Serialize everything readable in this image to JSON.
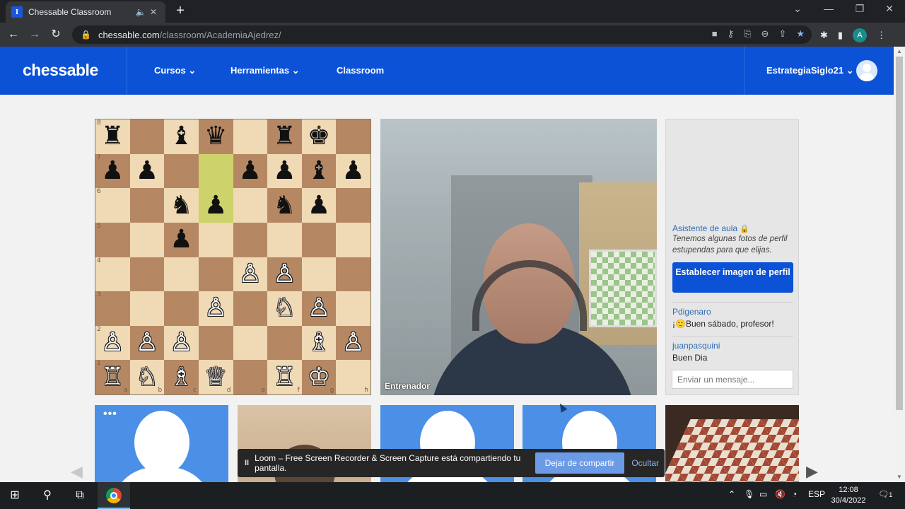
{
  "browser": {
    "tab_title": "Chessable Classroom",
    "favicon_letter": "I",
    "new_tab": "+",
    "url_host": "chessable.com",
    "url_path": "/classroom/AcademiaAjedrez/",
    "profile_letter": "A",
    "icons": [
      "back-icon",
      "forward-icon",
      "reload-icon",
      "lock-icon",
      "camera-icon",
      "key-icon",
      "translate-icon",
      "zoom-icon",
      "share-icon",
      "star-icon",
      "extensions-icon",
      "sidepanel-icon",
      "menu-icon"
    ]
  },
  "nav": {
    "logo": "chessable",
    "items": [
      {
        "label": "Cursos"
      },
      {
        "label": "Herramientas"
      },
      {
        "label": "Classroom"
      }
    ],
    "username": "EstrategiaSiglo21"
  },
  "board": {
    "ranks": [
      "8",
      "7",
      "6",
      "5",
      "4",
      "3",
      "2",
      "1"
    ],
    "files": [
      "a",
      "b",
      "c",
      "d",
      "e",
      "f",
      "g",
      "h"
    ],
    "highlight": [
      "d7",
      "d6"
    ],
    "pieces": {
      "a8": "♜",
      "c8": "♝",
      "d8": "♛",
      "f8": "♜",
      "g8": "♚",
      "a7": "♟",
      "b7": "♟",
      "e7": "♟",
      "f7": "♟",
      "g7": "♝",
      "h7": "♟",
      "c6": "♞",
      "d6": "♟",
      "f6": "♞",
      "g6": "♟",
      "c5": "♟",
      "e4": "♙",
      "f4": "♙",
      "d3": "♙",
      "f3": "♘",
      "g3": "♙",
      "a2": "♙",
      "b2": "♙",
      "c2": "♙",
      "g2": "♗",
      "h2": "♙",
      "a1": "♖",
      "b1": "♘",
      "c1": "♗",
      "d1": "♕",
      "f1": "♖",
      "g1": "♔"
    }
  },
  "video": {
    "label": "Entrenador"
  },
  "panel": {
    "assistant_title": "Asistente de aula",
    "assistant_text": "Tenemos algunas fotos de perfil estupendas para que elijas.",
    "set_image_button": "Establecer imagen de perfil",
    "messages": [
      {
        "user": "Pdigenaro",
        "text": "¡🙂Buen sábado, profesor!"
      },
      {
        "user": "juanpasquini",
        "text": "Buen Dia"
      }
    ],
    "input_placeholder": "Enviar un mensaje..."
  },
  "tiles": {
    "dots": "•••"
  },
  "loom": {
    "pause": "II",
    "text": "Loom – Free Screen Recorder & Screen Capture está compartiendo tu pantalla.",
    "stop_button": "Dejar de compartir",
    "hide_button": "Ocultar"
  },
  "taskbar": {
    "language": "ESP",
    "time": "12:08",
    "date": "30/4/2022",
    "notifications": "1"
  }
}
